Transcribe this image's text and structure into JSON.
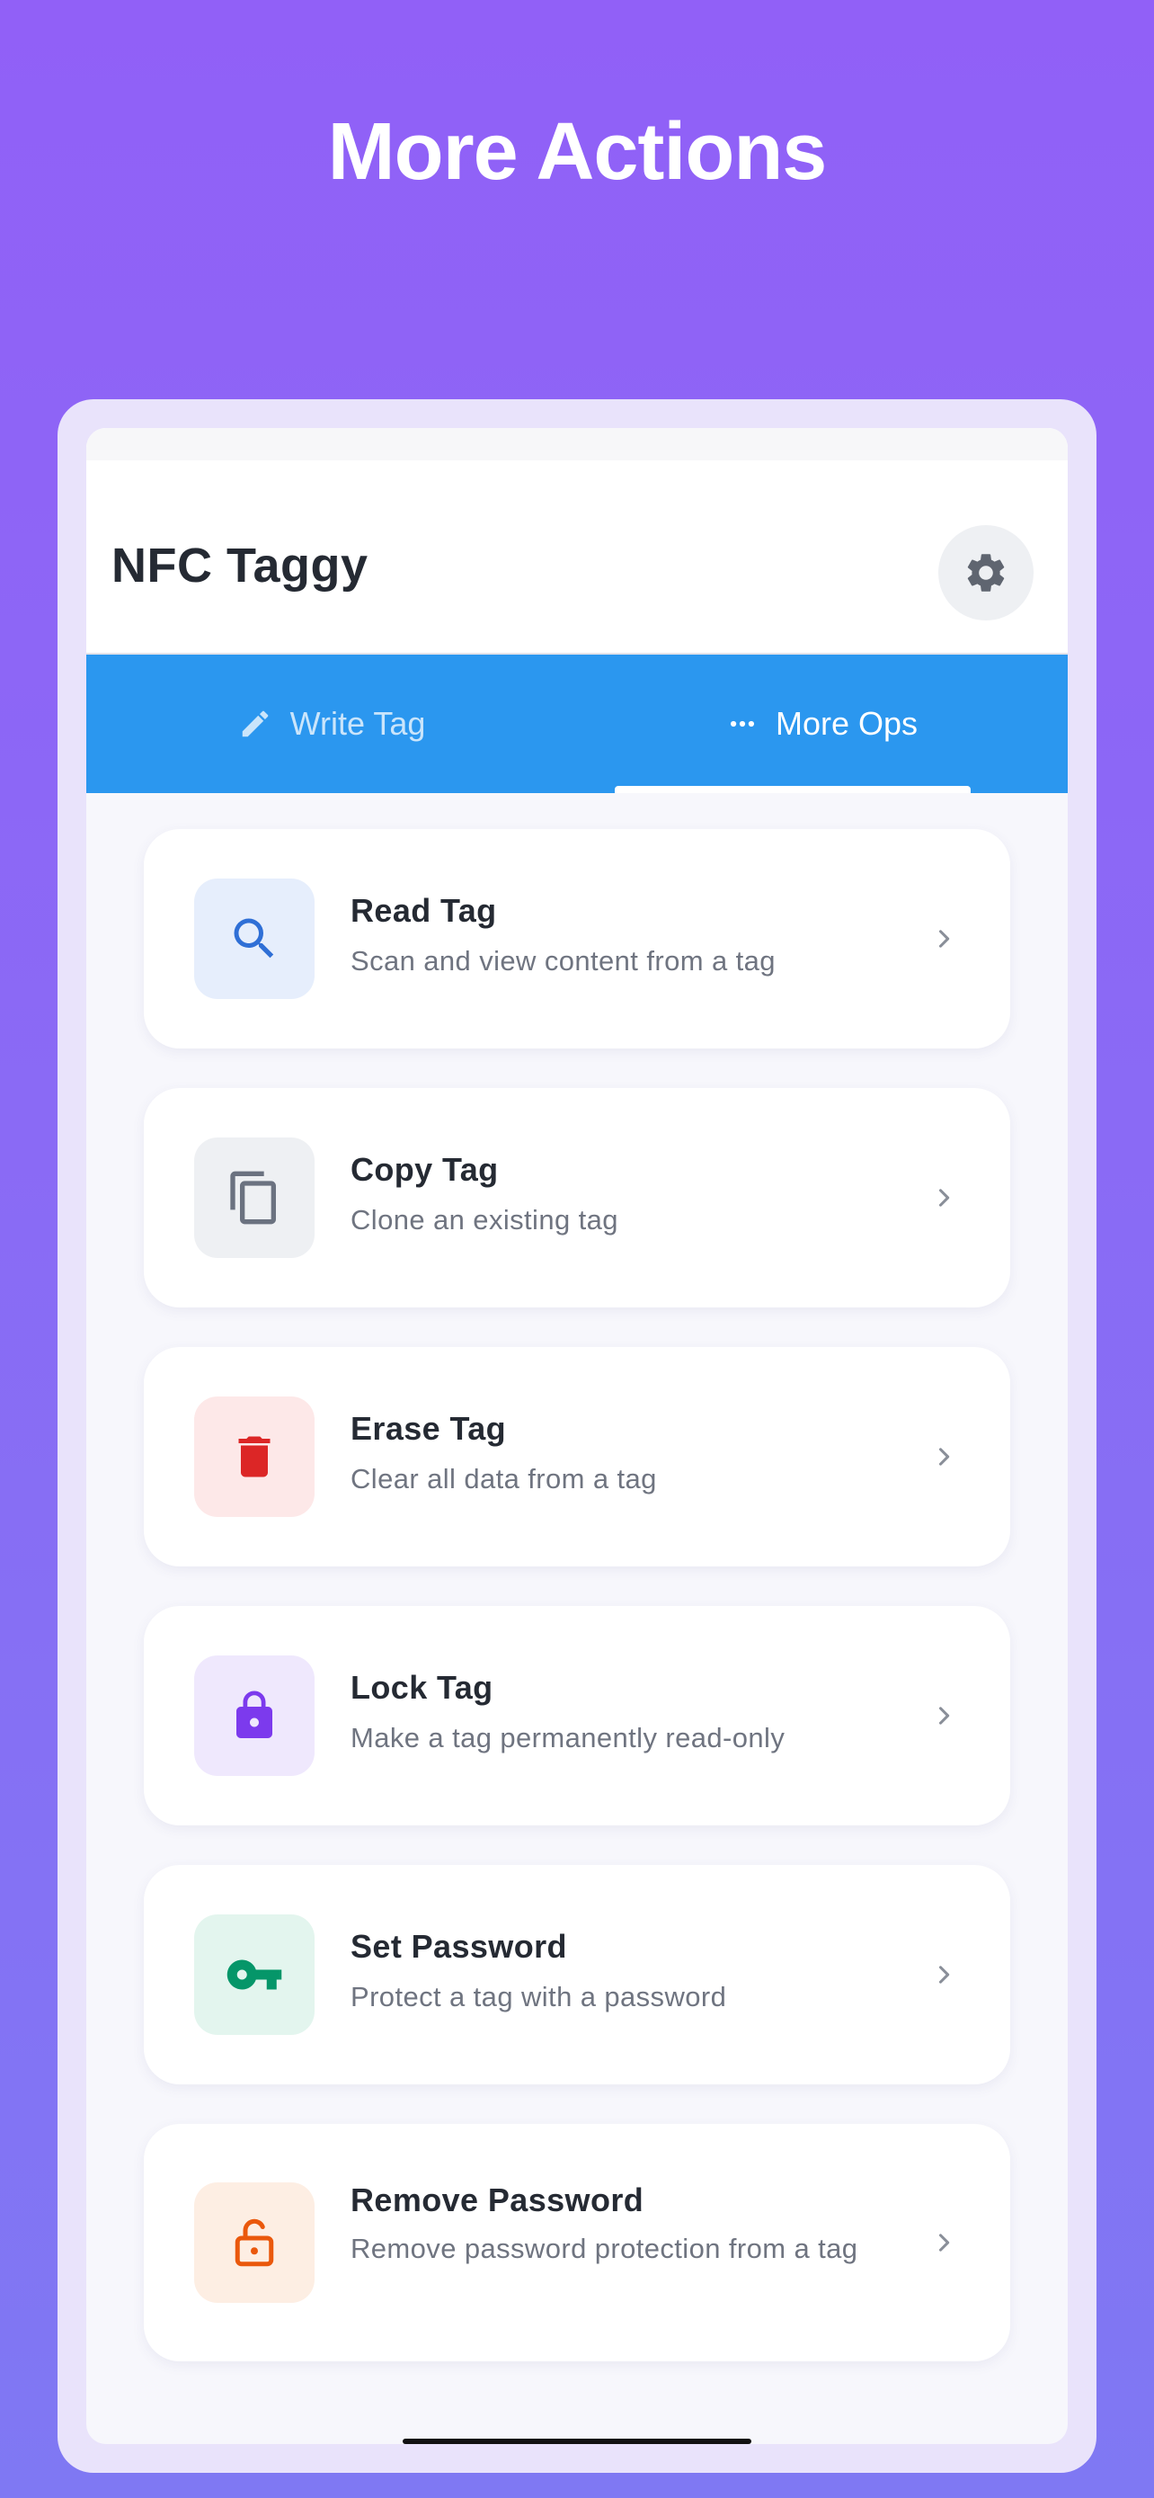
{
  "promo": {
    "title": "More Actions"
  },
  "app_bar": {
    "title": "NFC Taggy",
    "settings_icon": "gear-icon"
  },
  "tabs": [
    {
      "label": "Write Tag",
      "icon": "pencil-icon",
      "selected": false
    },
    {
      "label": "More Ops",
      "icon": "dots-icon",
      "selected": true
    }
  ],
  "actions": [
    {
      "title": "Read Tag",
      "subtitle": "Scan and view content from a tag",
      "icon": "search-icon",
      "icon_color": "#2f6fd6",
      "icon_bg": "#e6eefc"
    },
    {
      "title": "Copy Tag",
      "subtitle": "Clone an existing tag",
      "icon": "copy-icon",
      "icon_color": "#6b7280",
      "icon_bg": "#eef0f3"
    },
    {
      "title": "Erase Tag",
      "subtitle": "Clear all data from a tag",
      "icon": "trash-icon",
      "icon_color": "#dc2626",
      "icon_bg": "#fde8e8"
    },
    {
      "title": "Lock Tag",
      "subtitle": "Make a tag permanently read-only",
      "icon": "lock-icon",
      "icon_color": "#7c3aed",
      "icon_bg": "#efe8fd"
    },
    {
      "title": "Set Password",
      "subtitle": "Protect a tag with a password",
      "icon": "key-icon",
      "icon_color": "#059669",
      "icon_bg": "#e3f5ee"
    },
    {
      "title": "Remove Password",
      "subtitle": "Remove password protection from a tag",
      "icon": "unlock-icon",
      "icon_color": "#ea580c",
      "icon_bg": "#fdeee3"
    }
  ],
  "colors": {
    "tab_bar": "#2b97ef",
    "background_top": "#9160f7",
    "background_bottom": "#7f78f3"
  }
}
